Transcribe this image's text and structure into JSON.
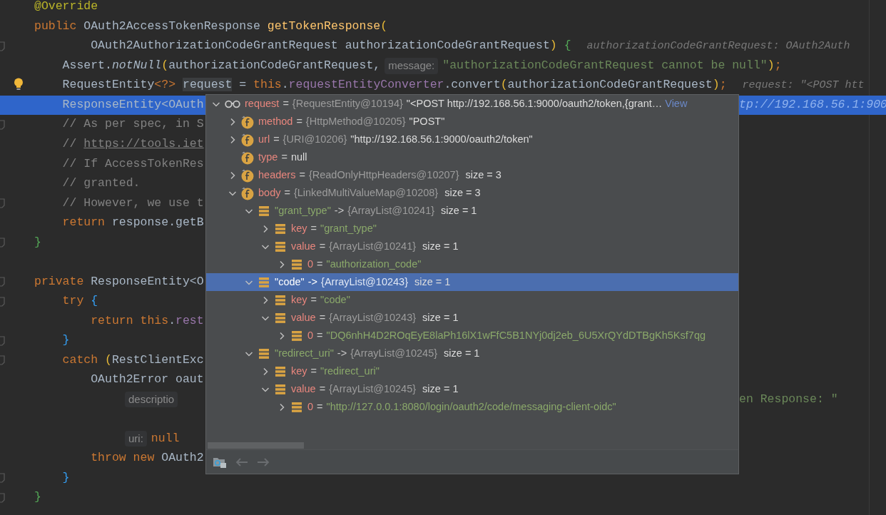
{
  "editor": {
    "lines": [
      {
        "selected": false,
        "fold": false,
        "bulb": false,
        "tokens": [
          {
            "t": "@Override",
            "kind": "ann"
          }
        ]
      },
      {
        "selected": false,
        "fold": false,
        "bulb": false,
        "tokens": [
          {
            "t": "public ",
            "kind": "kw"
          },
          {
            "t": "OAuth2AccessTokenResponse ",
            "kind": "plain"
          },
          {
            "t": "getTokenResponse",
            "kind": "fn"
          },
          {
            "t": "(",
            "kind": "paren"
          }
        ]
      },
      {
        "selected": false,
        "fold": true,
        "bulb": false,
        "tokens": [
          {
            "t": "        OAuth2AuthorizationCodeGrantRequest authorizationCodeGrantRequest",
            "kind": "plain"
          },
          {
            "t": ")",
            "kind": "paren"
          },
          {
            "t": " {",
            "kind": "brace_green"
          },
          {
            "t": "authorizationCodeGrantRequest: OAuth2Auth",
            "kind": "hint"
          }
        ]
      },
      {
        "selected": false,
        "fold": false,
        "bulb": false,
        "tokens": [
          {
            "t": "    Assert.",
            "kind": "plain"
          },
          {
            "t": "notNull",
            "kind": "static"
          },
          {
            "t": "(",
            "kind": "paren"
          },
          {
            "t": "authorizationCodeGrantRequest,",
            "kind": "plain"
          },
          {
            "t": "message:",
            "kind": "label"
          },
          {
            "t": "\"authorizationCodeGrantRequest cannot be null\"",
            "kind": "str"
          },
          {
            "t": ")",
            "kind": "paren"
          },
          {
            "t": ";",
            "kind": "kw"
          }
        ]
      },
      {
        "selected": false,
        "fold": false,
        "bulb": true,
        "tokens": [
          {
            "t": "    RequestEntity",
            "kind": "plain"
          },
          {
            "t": "<?>",
            "kind": "kw"
          },
          {
            "t": "request",
            "kind": "usage"
          },
          {
            "t": " = ",
            "kind": "plain"
          },
          {
            "t": "this",
            "kind": "kw"
          },
          {
            "t": ".",
            "kind": "plain"
          },
          {
            "t": "requestEntityConverter",
            "kind": "field"
          },
          {
            "t": ".convert",
            "kind": "plain"
          },
          {
            "t": "(",
            "kind": "paren"
          },
          {
            "t": "authorizationCodeGrantRequest",
            "kind": "plain"
          },
          {
            "t": ")",
            "kind": "paren"
          },
          {
            "t": ";",
            "kind": "kw"
          },
          {
            "t": "request: \"<POST htt",
            "kind": "hint"
          }
        ]
      },
      {
        "selected": true,
        "fold": false,
        "bulb": false,
        "tokens": [
          {
            "t": "    ResponseEntity<OAuth",
            "kind": "plain"
          }
        ],
        "tail": [
          {
            "t": "tp://192.168.56.1:900",
            "kind": "hint"
          }
        ]
      },
      {
        "selected": false,
        "fold": true,
        "bulb": false,
        "tokens": [
          {
            "t": "    // As per spec, in S",
            "kind": "cmt"
          }
        ]
      },
      {
        "selected": false,
        "fold": false,
        "bulb": false,
        "tokens": [
          {
            "t": "    // ",
            "kind": "cmt"
          },
          {
            "t": "https://tools.iet",
            "kind": "url"
          }
        ]
      },
      {
        "selected": false,
        "fold": false,
        "bulb": false,
        "tokens": [
          {
            "t": "    // If AccessTokenRes",
            "kind": "cmt"
          }
        ]
      },
      {
        "selected": false,
        "fold": false,
        "bulb": false,
        "tokens": [
          {
            "t": "    // granted.",
            "kind": "cmt"
          }
        ]
      },
      {
        "selected": false,
        "fold": true,
        "bulb": false,
        "tokens": [
          {
            "t": "    // However, we use t",
            "kind": "cmt"
          }
        ]
      },
      {
        "selected": false,
        "fold": false,
        "bulb": false,
        "tokens": [
          {
            "t": "    return ",
            "kind": "kw"
          },
          {
            "t": "response.getB",
            "kind": "plain"
          }
        ]
      },
      {
        "selected": false,
        "fold": true,
        "bulb": false,
        "tokens": [
          {
            "t": "}",
            "kind": "brace_green"
          }
        ]
      },
      {
        "selected": false,
        "fold": false,
        "bulb": false
      },
      {
        "selected": false,
        "fold": true,
        "bulb": false,
        "tokens": [
          {
            "t": "private ",
            "kind": "kw"
          },
          {
            "t": "ResponseEntity<O",
            "kind": "plain"
          }
        ]
      },
      {
        "selected": false,
        "fold": true,
        "bulb": false,
        "tokens": [
          {
            "t": "    try ",
            "kind": "kw"
          },
          {
            "t": "{",
            "kind": "brace_blue"
          }
        ]
      },
      {
        "selected": false,
        "fold": false,
        "bulb": false,
        "tokens": [
          {
            "t": "        return this",
            "kind": "kw"
          },
          {
            "t": ".",
            "kind": "plain"
          },
          {
            "t": "rest",
            "kind": "field"
          }
        ]
      },
      {
        "selected": false,
        "fold": true,
        "bulb": false,
        "tokens": [
          {
            "t": "    }",
            "kind": "brace_blue"
          }
        ]
      },
      {
        "selected": false,
        "fold": true,
        "bulb": false,
        "tokens": [
          {
            "t": "    catch ",
            "kind": "kw"
          },
          {
            "t": "(",
            "kind": "paren"
          },
          {
            "t": "RestClientExc",
            "kind": "plain"
          }
        ]
      },
      {
        "selected": false,
        "fold": false,
        "bulb": false,
        "tokens": [
          {
            "t": "        OAuth2Error oaut",
            "kind": "plain"
          }
        ]
      },
      {
        "selected": false,
        "fold": false,
        "bulb": false,
        "tokens": [
          {
            "t": "descriptio",
            "kind": "label"
          }
        ],
        "tail": [
          {
            "t": "en Response: \"",
            "kind": "str"
          }
        ]
      },
      {
        "selected": false,
        "fold": false,
        "bulb": false
      },
      {
        "selected": false,
        "fold": false,
        "bulb": false,
        "tokens": [
          {
            "t": "uri:",
            "kind": "label"
          },
          {
            "t": "null",
            "kind": "kw"
          }
        ]
      },
      {
        "selected": false,
        "fold": false,
        "bulb": false,
        "tokens": [
          {
            "t": "        throw new ",
            "kind": "kw"
          },
          {
            "t": "OAuth2",
            "kind": "plain"
          }
        ]
      },
      {
        "selected": false,
        "fold": true,
        "bulb": false,
        "tokens": [
          {
            "t": "    }",
            "kind": "brace_blue"
          }
        ]
      },
      {
        "selected": false,
        "fold": true,
        "bulb": false,
        "tokens": [
          {
            "t": "}",
            "kind": "brace_green"
          }
        ]
      }
    ]
  },
  "popup": {
    "tree": [
      {
        "kind": "watch",
        "name": "request",
        "string_name": false,
        "op": "=",
        "type": "{RequestEntity@10194}",
        "value": "\"<POST http://192.168.56.1:9000/oauth2/token,{grant…",
        "string_value": false,
        "link": "View",
        "expanded": true,
        "selected": false,
        "children": [
          {
            "kind": "field",
            "name": "method",
            "string_name": false,
            "op": "=",
            "type": "{HttpMethod@10205}",
            "value": "\"POST\"",
            "string_value": false,
            "expanded": false,
            "selected": false
          },
          {
            "kind": "field",
            "name": "url",
            "string_name": false,
            "op": "=",
            "type": "{URI@10206}",
            "value": "\"http://192.168.56.1:9000/oauth2/token\"",
            "string_value": false,
            "expanded": false,
            "selected": false
          },
          {
            "kind": "field",
            "name": "type",
            "string_name": false,
            "op": "=",
            "value": "null",
            "string_value": false,
            "selected": false
          },
          {
            "kind": "field",
            "name": "headers",
            "string_name": false,
            "op": "=",
            "type": "{ReadOnlyHttpHeaders@10207}",
            "size": "size = 3",
            "expanded": false,
            "selected": false
          },
          {
            "kind": "field",
            "name": "body",
            "string_name": false,
            "op": "=",
            "type": "{LinkedMultiValueMap@10208}",
            "size": "size = 3",
            "expanded": true,
            "selected": false,
            "children": [
              {
                "kind": "entry",
                "name": "\"grant_type\"",
                "string_name": true,
                "op": "->",
                "type": "{ArrayList@10241}",
                "size": "size = 1",
                "expanded": true,
                "selected": false,
                "children": [
                  {
                    "kind": "entry",
                    "name": "key",
                    "string_name": false,
                    "op": "=",
                    "value": "\"grant_type\"",
                    "string_value": true,
                    "expanded": false,
                    "selected": false
                  },
                  {
                    "kind": "entry",
                    "name": "value",
                    "string_name": false,
                    "op": "=",
                    "type": "{ArrayList@10241}",
                    "size": "size = 1",
                    "expanded": true,
                    "selected": false,
                    "children": [
                      {
                        "kind": "entry",
                        "name": "0",
                        "string_name": false,
                        "op": "=",
                        "value": "\"authorization_code\"",
                        "string_value": true,
                        "expanded": false,
                        "selected": false
                      }
                    ]
                  }
                ]
              },
              {
                "kind": "entry",
                "name": "\"code\"",
                "string_name": true,
                "op": "->",
                "type": "{ArrayList@10243}",
                "size": "size = 1",
                "expanded": true,
                "selected": true,
                "children": [
                  {
                    "kind": "entry",
                    "name": "key",
                    "string_name": false,
                    "op": "=",
                    "value": "\"code\"",
                    "string_value": true,
                    "expanded": false,
                    "selected": false
                  },
                  {
                    "kind": "entry",
                    "name": "value",
                    "string_name": false,
                    "op": "=",
                    "type": "{ArrayList@10243}",
                    "size": "size = 1",
                    "expanded": true,
                    "selected": false,
                    "children": [
                      {
                        "kind": "entry",
                        "name": "0",
                        "string_name": false,
                        "op": "=",
                        "value": "\"DQ6nhH4D2ROqEyE8laPh16lX1wFfC5B1NYj0dj2eb_6U5XrQYdDTBgKh5Ksf7qg",
                        "string_value": true,
                        "expanded": false,
                        "selected": false
                      }
                    ]
                  }
                ]
              },
              {
                "kind": "entry",
                "name": "\"redirect_uri\"",
                "string_name": true,
                "op": "->",
                "type": "{ArrayList@10245}",
                "size": "size = 1",
                "expanded": true,
                "selected": false,
                "children": [
                  {
                    "kind": "entry",
                    "name": "key",
                    "string_name": false,
                    "op": "=",
                    "value": "\"redirect_uri\"",
                    "string_value": true,
                    "expanded": false,
                    "selected": false
                  },
                  {
                    "kind": "entry",
                    "name": "value",
                    "string_name": false,
                    "op": "=",
                    "type": "{ArrayList@10245}",
                    "size": "size = 1",
                    "expanded": true,
                    "selected": false,
                    "children": [
                      {
                        "kind": "entry",
                        "name": "0",
                        "string_name": false,
                        "op": "=",
                        "value": "\"http://127.0.0.1:8080/login/oauth2/code/messaging-client-oidc\"",
                        "string_value": true,
                        "expanded": false,
                        "selected": false
                      }
                    ]
                  }
                ]
              }
            ]
          }
        ]
      }
    ]
  }
}
